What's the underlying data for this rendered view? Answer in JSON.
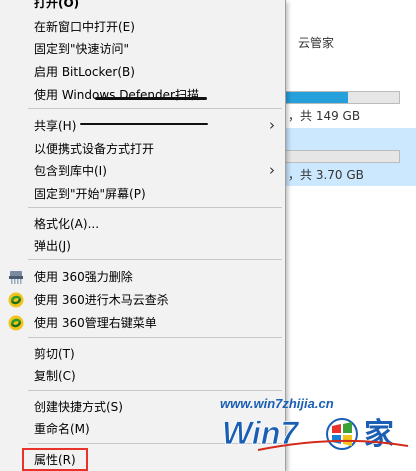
{
  "background": {
    "cloud_label": "云管家",
    "drive1_free": "，共 149 GB",
    "drive1_fill": 0.55,
    "drive2_free": "，共 3.70 GB",
    "drive2_fill": 0.0
  },
  "menu": {
    "items": [
      {
        "label": "打开(O)"
      },
      {
        "label": "在新窗口中打开(E)"
      },
      {
        "label": "固定到\"快速访问\""
      },
      {
        "label": "启用 BitLocker(B)"
      },
      {
        "label": "使用 Windows Defender扫描"
      },
      {
        "label": "共享(H)",
        "submenu": true
      },
      {
        "label": "以便携式设备方式打开"
      },
      {
        "label": "包含到库中(I)",
        "submenu": true
      },
      {
        "label": "固定到\"开始\"屏幕(P)"
      },
      {
        "label": "格式化(A)..."
      },
      {
        "label": "弹出(J)"
      },
      {
        "label": "使用 360强力删除",
        "icon": "shredder-icon"
      },
      {
        "label": "使用 360进行木马云查杀",
        "icon": "360-shield-icon"
      },
      {
        "label": "使用 360管理右键菜单",
        "icon": "360-shield-icon"
      },
      {
        "label": "剪切(T)"
      },
      {
        "label": "复制(C)"
      },
      {
        "label": "创建快捷方式(S)"
      },
      {
        "label": "重命名(M)"
      },
      {
        "label": "属性(R)"
      }
    ]
  },
  "watermark": {
    "url": "www.win7zhijia.cn",
    "brand_main": "Win7",
    "brand_suffix": "家",
    "colors": {
      "text": "#1a5fb4",
      "accent": "#d42a1c"
    }
  },
  "colors": {
    "highlight": "#e8322b",
    "menu_bg": "#f2f2f2",
    "selection": "#cce8ff"
  }
}
